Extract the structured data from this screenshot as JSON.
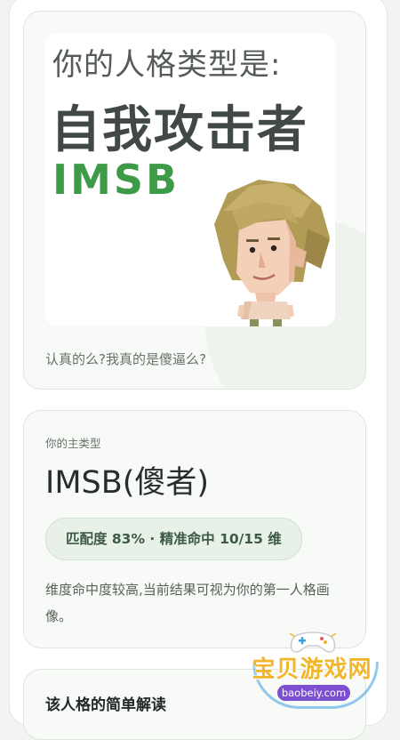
{
  "result": {
    "poster_heading": "你的人格类型是:",
    "poster_name": "自我攻击者",
    "poster_code": "IMSB",
    "quote": "认真的么?我真的是傻逼么?"
  },
  "main_type": {
    "label": "你的主类型",
    "title": "IMSB(傻者)",
    "match": "匹配度 83% · 精准命中 10/15 维",
    "description": "维度命中度较高,当前结果可视为你的第一人格画像。"
  },
  "brief": {
    "title": "该人格的简单解读"
  },
  "watermark": {
    "brand": "宝贝游戏网",
    "url": "baobeiy.com"
  },
  "colors": {
    "accent_green": "#3d9a47",
    "pill_bg": "#e8f1e7",
    "watermark_gold": "#f1b62c",
    "watermark_purple": "#7b4fd0"
  },
  "icons": {
    "figure": "curly-haired-character-illustration",
    "gamepad": "gamepad-icon"
  }
}
